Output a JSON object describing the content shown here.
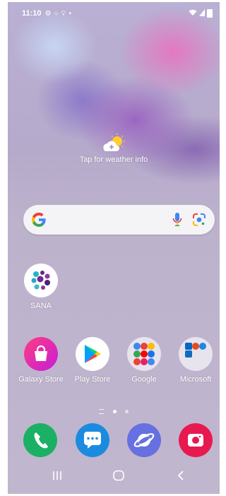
{
  "status_bar": {
    "time": "11:10"
  },
  "weather": {
    "label": "Tap for weather info"
  },
  "search_bar": {
    "placeholder": ""
  },
  "apps": {
    "sana": "SANA",
    "galaxy_store": "Galaxy Store",
    "play_store": "Play Store",
    "google_folder": "Google",
    "microsoft_folder": "Microsoft"
  },
  "dock": {
    "phone": "phone-icon",
    "messages": "messages-icon",
    "internet": "internet-icon",
    "camera": "camera-icon"
  },
  "page_indicator": {
    "pages": 2,
    "current": 1
  },
  "colors": {
    "accent_green": "#1ab164",
    "accent_blue": "#1b8be0",
    "accent_purple": "#6670e0",
    "accent_red": "#e8194f"
  }
}
